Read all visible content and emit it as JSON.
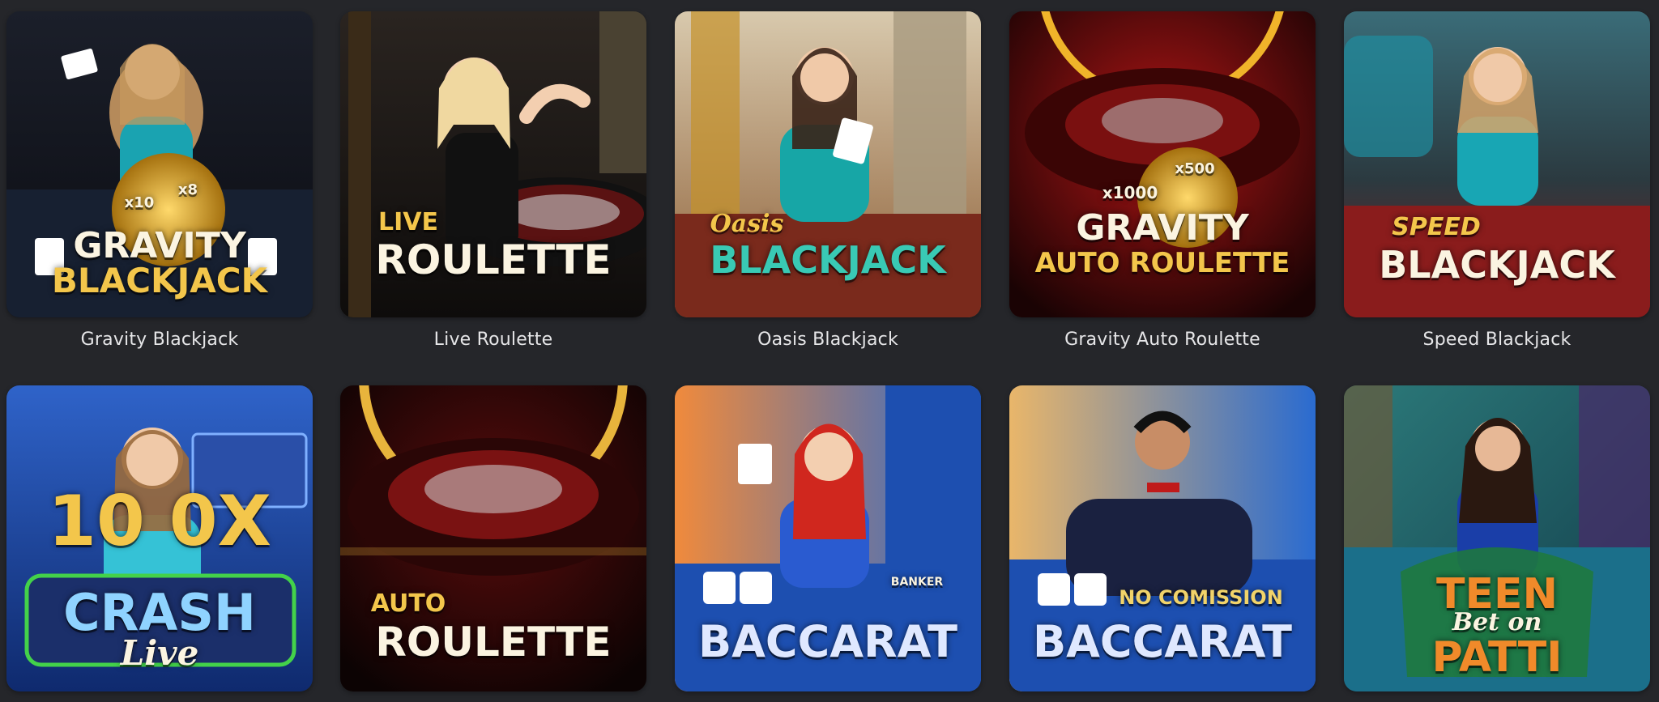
{
  "games": [
    {
      "name": "Gravity Blackjack",
      "art": {
        "line1": "GRAVITY",
        "line2": "BLACKJACK",
        "badge_a": "x10",
        "badge_b": "x8"
      },
      "colors": {
        "bg1": "#1b1f2a",
        "bg2": "#0b0c12",
        "accent": "#d9a21c"
      }
    },
    {
      "name": "Live Roulette",
      "art": {
        "line1": "LIVE",
        "line2": "ROULETTE"
      },
      "colors": {
        "bg1": "#2a2420",
        "bg2": "#0e0c0b",
        "accent": "#e3b14a"
      }
    },
    {
      "name": "Oasis Blackjack",
      "art": {
        "line1": "Oasis",
        "line2": "BLACKJACK"
      },
      "colors": {
        "bg1": "#c9b79a",
        "bg2": "#8a5a3a",
        "accent": "#2fb9a5"
      }
    },
    {
      "name": "Gravity Auto Roulette",
      "art": {
        "line1": "GRAVITY",
        "line2": "AUTO ROULETTE",
        "badge_a": "x1000",
        "badge_b": "x500"
      },
      "colors": {
        "bg1": "#7a0c0c",
        "bg2": "#1a0304",
        "accent": "#f0b42a"
      }
    },
    {
      "name": "Speed Blackjack",
      "art": {
        "line1": "SPEED",
        "line2": "BLACKJACK"
      },
      "colors": {
        "bg1": "#3a6c78",
        "bg2": "#7a1a1a",
        "accent": "#e6b445"
      }
    },
    {
      "name": "Crash Live",
      "art": {
        "line1": "10 0X",
        "line2": "CRASH",
        "line3": "Live"
      },
      "colors": {
        "bg1": "#2f63c9",
        "bg2": "#0f2a6e",
        "accent": "#f2c33c"
      }
    },
    {
      "name": "Auto Roulette",
      "art": {
        "line1": "AUTO",
        "line2": "ROULETTE"
      },
      "colors": {
        "bg1": "#3a0a0a",
        "bg2": "#0c0303",
        "accent": "#e8b43c"
      }
    },
    {
      "name": "Baccarat",
      "art": {
        "line1": "BACCARAT",
        "sub": "BANKER"
      },
      "colors": {
        "bg1": "#f08a3c",
        "bg2": "#1d4fb0",
        "accent": "#e0e8ff"
      }
    },
    {
      "name": "No Commission Baccarat",
      "art": {
        "line1": "BACCARAT",
        "sub": "NO COMISSION"
      },
      "colors": {
        "bg1": "#e9b66a",
        "bg2": "#1d4fb0",
        "accent": "#f1d36a"
      }
    },
    {
      "name": "Teen Patti",
      "art": {
        "line1": "TEEN",
        "line2": "Bet on",
        "line3": "PATTI"
      },
      "colors": {
        "bg1": "#2c7a7a",
        "bg2": "#123c4a",
        "accent": "#f08a2a"
      }
    }
  ]
}
